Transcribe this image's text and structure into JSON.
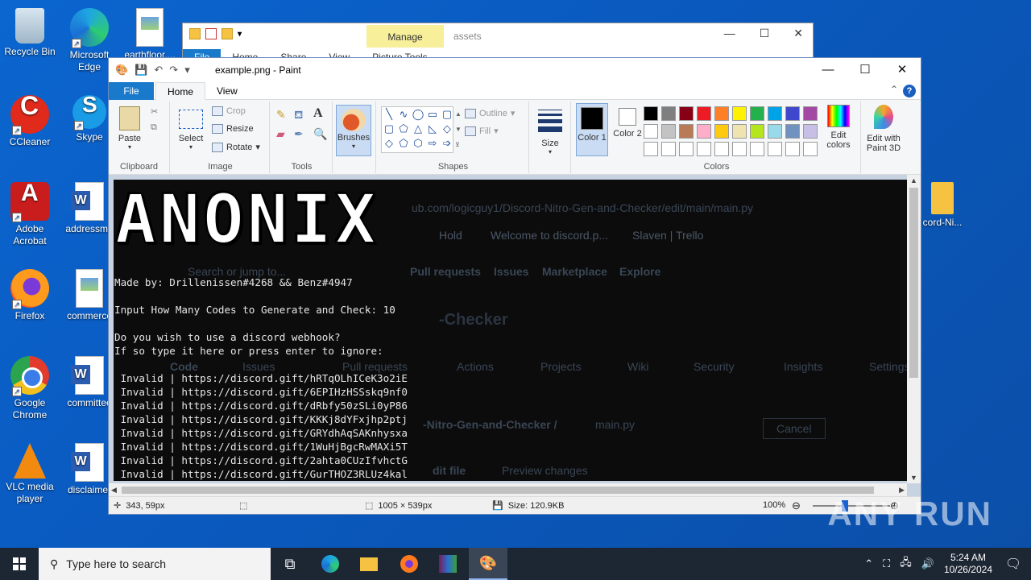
{
  "desktop": {
    "icons_col1": [
      {
        "label": "Recycle Bin",
        "icon": "recycle-bin-icon"
      },
      {
        "label": "CCleaner",
        "icon": "ccleaner-icon"
      },
      {
        "label": "Adobe Acrobat",
        "icon": "adobe-acrobat-icon"
      },
      {
        "label": "Firefox",
        "icon": "firefox-icon"
      },
      {
        "label": "Google Chrome",
        "icon": "chrome-icon"
      },
      {
        "label": "VLC media player",
        "icon": "vlc-icon"
      }
    ],
    "icons_col2": [
      {
        "label": "Microsoft Edge",
        "icon": "edge-icon"
      },
      {
        "label": "Skype",
        "icon": "skype-icon"
      },
      {
        "label": "addressmo",
        "icon": "word-doc-icon"
      },
      {
        "label": "commerce",
        "icon": "image-file-icon"
      },
      {
        "label": "committee",
        "icon": "word-doc-icon"
      },
      {
        "label": "disclaimer",
        "icon": "word-doc-icon"
      }
    ],
    "icon_earthfloor": "earthfloor....",
    "icon_right": "cord-Ni..."
  },
  "explorer": {
    "manage": "Manage",
    "path": "assets",
    "tabs": [
      "File",
      "Home",
      "Share",
      "View",
      "Picture Tools"
    ]
  },
  "paint": {
    "title": "example.png - Paint",
    "tabs": {
      "file": "File",
      "home": "Home",
      "view": "View"
    },
    "ribbon": {
      "paste": "Paste",
      "clipboard": "Clipboard",
      "select": "Select",
      "crop": "Crop",
      "resize": "Resize",
      "rotate": "Rotate",
      "image": "Image",
      "tools": "Tools",
      "brushes": "Brushes",
      "outline": "Outline",
      "fill": "Fill",
      "shapes": "Shapes",
      "size": "Size",
      "color1": "Color 1",
      "color2": "Color 2",
      "colors": "Colors",
      "edit_colors": "Edit colors",
      "edit_paint3d": "Edit with Paint 3D"
    },
    "palette": [
      "#000000",
      "#7f7f7f",
      "#880015",
      "#ed1c24",
      "#ff7f27",
      "#fff200",
      "#22b14c",
      "#00a2e8",
      "#3f48cc",
      "#a349a4",
      "#ffffff",
      "#c3c3c3",
      "#b97a57",
      "#ffaec9",
      "#ffc90e",
      "#efe4b0",
      "#b5e61d",
      "#99d9ea",
      "#7092be",
      "#c8bfe7",
      "#ffffff",
      "#ffffff",
      "#ffffff",
      "#ffffff",
      "#ffffff",
      "#ffffff",
      "#ffffff",
      "#ffffff",
      "#ffffff",
      "#ffffff"
    ],
    "color1": "#000000",
    "color2": "#ffffff",
    "canvas": {
      "banner": "ANONIX",
      "made_by": "Made by: Drillenissen#4268 && Benz#4947",
      "prompt_count": "Input How Many Codes to Generate and Check: 10",
      "webhook_q1": "Do you wish to use a discord webhook?",
      "webhook_q2": "If so type it here or press enter to ignore:",
      "results": [
        " Invalid | https://discord.gift/hRTqOLhICeK3o2iE",
        " Invalid | https://discord.gift/6EPIHzHSSskq9nf0",
        " Invalid | https://discord.gift/dRbfy50zSLi0yP86",
        " Invalid | https://discord.gift/KKKj8dYFxjhp2ptj",
        " Invalid | https://discord.gift/GRYdhAqSAKnhysxa",
        " Invalid | https://discord.gift/1WuHjBgcRwMAXi5T",
        " Invalid | https://discord.gift/2ahta0CUzIfvhctG",
        " Invalid | https://discord.gift/GurTHOZ3RLUz4kal"
      ],
      "ghost_url": "ub.com/logicguy1/Discord-Nitro-Gen-and-Checker/edit/main/main.py",
      "ghost_bookmarks": [
        "Hold",
        "Welcome to discord.p...",
        "Slaven | Trello"
      ],
      "ghost_search": "Search or jump to...",
      "ghost_nav": [
        "Pull requests",
        "Issues",
        "Marketplace",
        "Explore"
      ],
      "ghost_repo": "-Checker",
      "ghost_tabs": [
        "Code",
        "Issues",
        "Pull requests",
        "Actions",
        "Projects",
        "Wiki",
        "Security",
        "Insights",
        "Settings"
      ],
      "ghost_file": "-Nitro-Gen-and-Checker /",
      "ghost_filename": "main.py",
      "ghost_cancel": "Cancel",
      "ghost_edit": "dit file",
      "ghost_preview": "Preview changes"
    },
    "status": {
      "cursor": "343, 59px",
      "selection": "1005 × 539px",
      "size": "Size: 120.9KB",
      "zoom": "100%"
    }
  },
  "watermark": "ANY RUN",
  "taskbar": {
    "search_placeholder": "Type here to search",
    "time": "5:24 AM",
    "date": "10/26/2024"
  }
}
